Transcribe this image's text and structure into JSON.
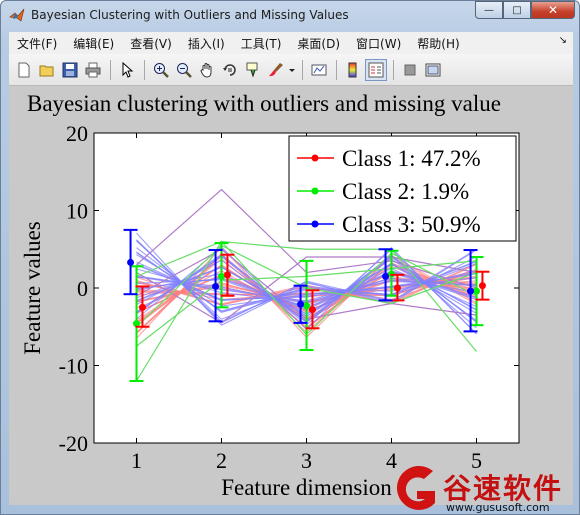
{
  "window": {
    "title": "Bayesian Clustering with Outliers and Missing Values",
    "controls": {
      "minimize": "—",
      "maximize": "□",
      "close": "✕"
    }
  },
  "menu": {
    "items": [
      "文件(F)",
      "编辑(E)",
      "查看(V)",
      "插入(I)",
      "工具(T)",
      "桌面(D)",
      "窗口(W)",
      "帮助(H)"
    ],
    "overflow": "↘"
  },
  "toolbar": {
    "buttons": [
      "new-figure-icon",
      "open-file-icon",
      "save-icon",
      "print-icon",
      "pointer-icon",
      "zoom-in-icon",
      "zoom-out-icon",
      "pan-hand-icon",
      "rotate-3d-icon",
      "data-cursor-icon",
      "brush-icon",
      "link-plot-icon",
      "colorbar-icon",
      "legend-icon",
      "hide-tools-icon",
      "show-tools-icon"
    ]
  },
  "chart_data": {
    "type": "line",
    "title": "Bayesian clustering with outliers and missing value",
    "xlabel": "Feature dimension",
    "ylabel": "Feature values",
    "xlim": [
      0.5,
      5.5
    ],
    "ylim": [
      -20,
      20
    ],
    "xticks": [
      "1",
      "2",
      "3",
      "4",
      "5"
    ],
    "yticks": [
      "-20",
      "-10",
      "0",
      "10",
      "20"
    ],
    "grid": false,
    "legend_position": "top-right",
    "colors": {
      "class1": "#ff0000",
      "class2": "#00ee00",
      "class3": "#0000ff",
      "class1_lines": "#ff8080",
      "class2_lines": "#66dd66",
      "class3_lines": "#8080ff",
      "outlier_lines": "#b07cc8"
    },
    "series": [
      {
        "name": "Class 1: 47.2%",
        "x_offset": 0.07,
        "means": [
          -2.5,
          1.7,
          -2.8,
          0.0,
          0.3
        ],
        "lower": [
          -5.0,
          -1.0,
          -5.2,
          -1.6,
          -1.5
        ],
        "upper": [
          0.2,
          4.3,
          -0.3,
          1.7,
          2.1
        ],
        "band_low": [
          -6.5,
          -2.5,
          -6.0,
          -2.0,
          -2.0
        ],
        "band_high": [
          1.5,
          5.0,
          0.5,
          4.0,
          3.0
        ]
      },
      {
        "name": "Class 2: 1.9%",
        "x_offset": 0.0,
        "means": [
          -4.6,
          1.5,
          -2.3,
          1.8,
          -0.4
        ],
        "lower": [
          -12.0,
          -2.5,
          -8.0,
          -1.0,
          -4.8
        ],
        "upper": [
          2.8,
          5.8,
          3.5,
          4.8,
          4.0
        ],
        "sample_lines": [
          [
            -12.0,
            6.0,
            -6.0,
            4.5,
            -1.0
          ],
          [
            1.5,
            6.0,
            5.0,
            5.0,
            -8.2
          ],
          [
            -7.5,
            1.0,
            1.5,
            2.5,
            3.5
          ],
          [
            -5.0,
            5.5,
            0.0,
            -2.0,
            2.0
          ]
        ]
      },
      {
        "name": "Class 3: 50.9%",
        "x_offset": -0.07,
        "means": [
          3.3,
          0.2,
          -2.1,
          1.5,
          -0.4
        ],
        "lower": [
          -0.8,
          -4.3,
          -4.5,
          -1.6,
          -5.6
        ],
        "upper": [
          7.5,
          4.9,
          0.3,
          5.0,
          4.9
        ],
        "band_low": [
          -4.0,
          -5.0,
          -5.0,
          -2.0,
          -6.0
        ],
        "band_high": [
          7.0,
          5.0,
          1.0,
          5.0,
          5.0
        ]
      }
    ],
    "outlier_lines": [
      [
        3.0,
        12.7,
        2.0,
        3.5,
        0.0
      ],
      [
        -1.0,
        5.0,
        -4.0,
        -2.0,
        -3.5
      ],
      [
        2.0,
        -4.5,
        4.0,
        4.0,
        2.0
      ]
    ]
  },
  "watermark": {
    "text": "谷速软件",
    "url": "www.gususoft.com"
  }
}
